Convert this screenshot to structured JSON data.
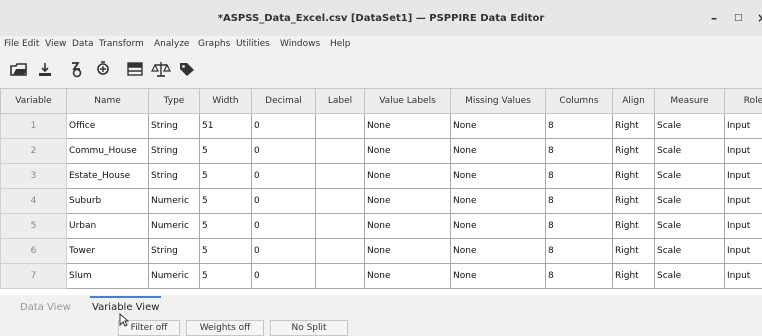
{
  "window": {
    "title": "*ASPSS_Data_Excel.csv [DataSet1] — PSPPIRE Data Editor",
    "minimize_glyph": "–",
    "maximize_glyph": "□",
    "close_glyph": "×"
  },
  "menu": [
    "File",
    "Edit",
    "View",
    "Data",
    "Transform",
    "Analyze",
    "Graphs",
    "Utilities",
    "Windows",
    "Help"
  ],
  "toolbar": [
    "open-file-icon",
    "save-icon",
    "goto-case-icon",
    "goto-variable-icon",
    "split-file-icon",
    "weight-cases-icon",
    "value-labels-icon"
  ],
  "columns": [
    "Variable",
    "Name",
    "Type",
    "Width",
    "Decimal",
    "Label",
    "Value Labels",
    "Missing Values",
    "Columns",
    "Align",
    "Measure",
    "Role"
  ],
  "rows": [
    {
      "num": "1",
      "name": "Office",
      "type": "String",
      "width": "51",
      "decimal": "0",
      "label": "",
      "value_labels": "None",
      "missing": "None",
      "columns": "8",
      "align": "Right",
      "measure": "Scale",
      "role": "Input"
    },
    {
      "num": "2",
      "name": "Commu_House",
      "type": "String",
      "width": "5",
      "decimal": "0",
      "label": "",
      "value_labels": "None",
      "missing": "None",
      "columns": "8",
      "align": "Right",
      "measure": "Scale",
      "role": "Input"
    },
    {
      "num": "3",
      "name": "Estate_House",
      "type": "String",
      "width": "5",
      "decimal": "0",
      "label": "",
      "value_labels": "None",
      "missing": "None",
      "columns": "8",
      "align": "Right",
      "measure": "Scale",
      "role": "Input"
    },
    {
      "num": "4",
      "name": "Suburb",
      "type": "Numeric",
      "width": "5",
      "decimal": "0",
      "label": "",
      "value_labels": "None",
      "missing": "None",
      "columns": "8",
      "align": "Right",
      "measure": "Scale",
      "role": "Input"
    },
    {
      "num": "5",
      "name": "Urban",
      "type": "Numeric",
      "width": "5",
      "decimal": "0",
      "label": "",
      "value_labels": "None",
      "missing": "None",
      "columns": "8",
      "align": "Right",
      "measure": "Scale",
      "role": "Input"
    },
    {
      "num": "6",
      "name": "Tower",
      "type": "String",
      "width": "5",
      "decimal": "0",
      "label": "",
      "value_labels": "None",
      "missing": "None",
      "columns": "8",
      "align": "Right",
      "measure": "Scale",
      "role": "Input"
    },
    {
      "num": "7",
      "name": "Slum",
      "type": "Numeric",
      "width": "5",
      "decimal": "0",
      "label": "",
      "value_labels": "None",
      "missing": "None",
      "columns": "8",
      "align": "Right",
      "measure": "Scale",
      "role": "Input"
    }
  ],
  "tabs": {
    "data_view": "Data View",
    "variable_view": "Variable View"
  },
  "status": {
    "filter": "Filter off",
    "weights": "Weights off",
    "split": "No Split"
  },
  "colors": {
    "accent": "#4a7fc1",
    "toolbar_icon": "#333333"
  }
}
